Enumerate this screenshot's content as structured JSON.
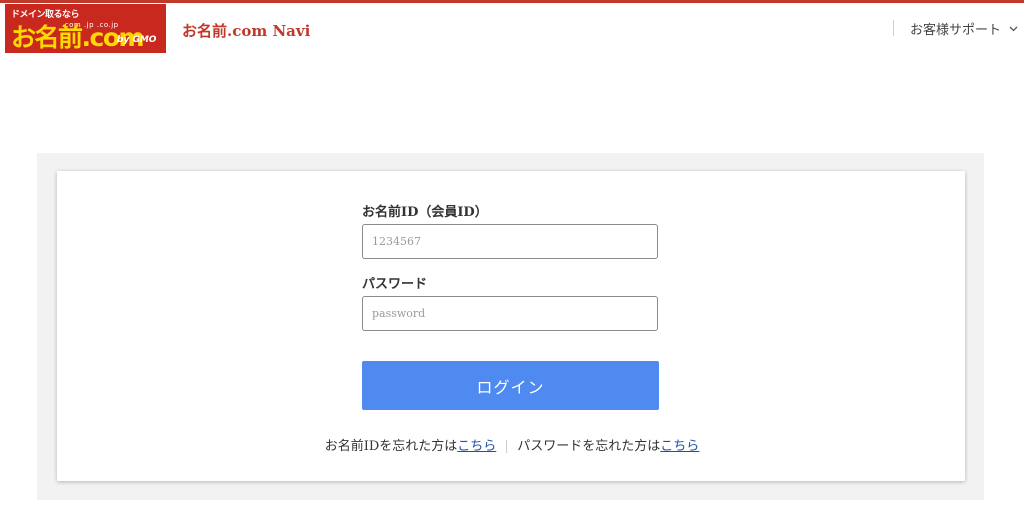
{
  "brand": {
    "tagline": "ドメイン取るなら",
    "tlds": ".com  .jp  .co.jp",
    "wordmark": "お名前.com",
    "by": "by GMO",
    "app_title": "お名前.com Navi",
    "accent_color": "#c0392b"
  },
  "header": {
    "support_menu_label": "お客様サポート",
    "support_menu_icon": "chevron-down-icon"
  },
  "login_form": {
    "member_id_label": "お名前ID（会員ID）",
    "member_id_value": "",
    "member_id_placeholder": "1234567",
    "password_label": "パスワード",
    "password_value": "",
    "password_placeholder": "password",
    "login_button_label": "ログイン",
    "button_color": "#4f8af0"
  },
  "help_links": {
    "forgot_id_text": "お名前IDを忘れた方は",
    "forgot_id_link": "こちら",
    "forgot_password_text": "パスワードを忘れた方は",
    "forgot_password_link": "こちら"
  }
}
